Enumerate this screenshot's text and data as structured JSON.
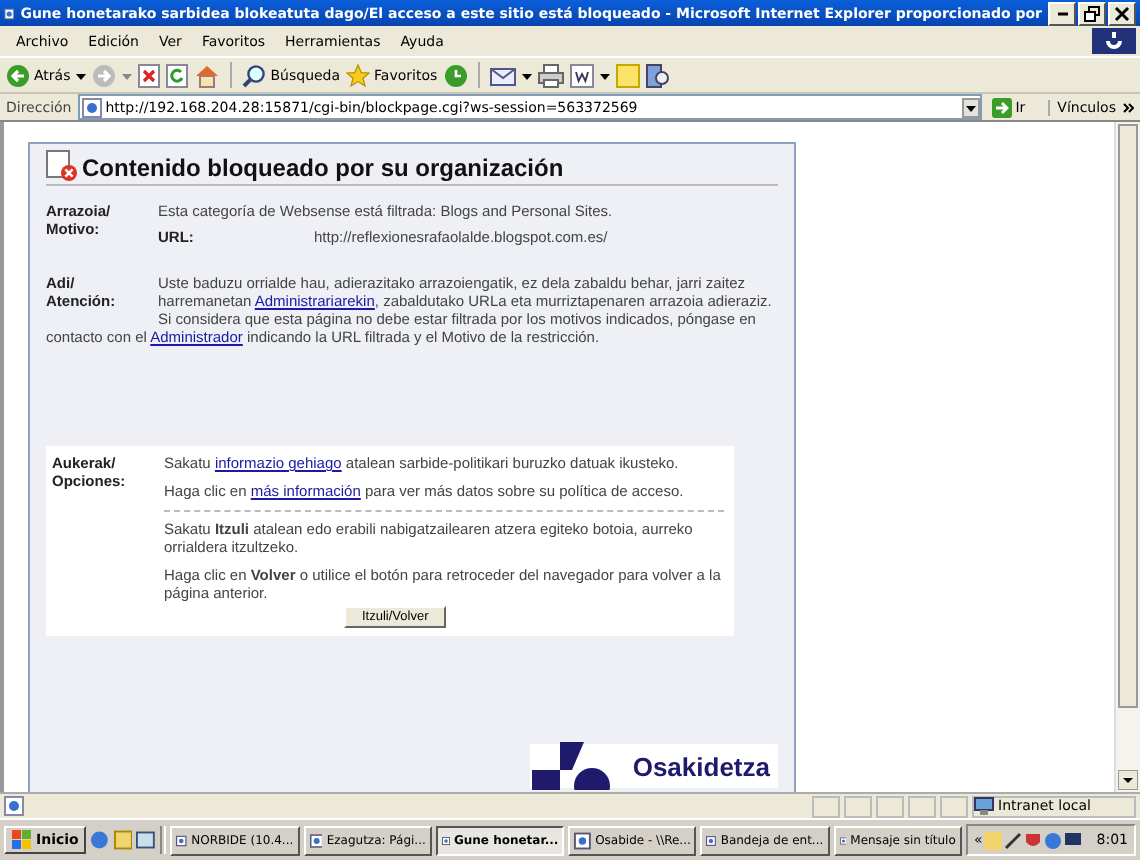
{
  "window": {
    "title": "Gune honetarako sarbidea blokeatuta dago/El acceso a este sitio está bloqueado - Microsoft Internet Explorer proporcionado por"
  },
  "menu_bar": [
    "Archivo",
    "Edición",
    "Ver",
    "Favoritos",
    "Herramientas",
    "Ayuda"
  ],
  "toolbar": {
    "back": "Atrás",
    "search": "Búsqueda",
    "favorites": "Favoritos"
  },
  "address_bar": {
    "label": "Dirección",
    "value": "http://192.168.204.28:15871/cgi-bin/blockpage.cgi?ws-session=563372569",
    "go": "Ir",
    "links": "Vínculos"
  },
  "page": {
    "heading": "Contenido bloqueado por su organización",
    "reason": {
      "label": "Arrazoia/ Motivo:",
      "text": "Esta categoría de Websense está filtrada: Blogs and Personal Sites.",
      "url_label": "URL:",
      "url": "http://reflexionesrafaolalde.blogspot.com.es/"
    },
    "attention": {
      "label": "Adi/ Atención:",
      "paragraphs": [
        {
          "before": "Uste baduzu orrialde hau, adierazitako arrazoiengatik, ez dela zabaldu behar, jarri zaitez harremanetan",
          "link": "Administrariarekin",
          "after": ", zabaldutako URLa eta murriztapenaren arrazoia adieraziz."
        },
        {
          "before": "Si considera que esta página no debe estar filtrada por los motivos indicados, póngase en contacto con el",
          "link": "Administrador",
          "after": "indicando la URL filtrada y el Motivo de la restricción."
        }
      ]
    },
    "options": {
      "label": "Aukerak/ Opciones:",
      "links": [
        {
          "before": "Sakatu",
          "link": "informazio gehiago",
          "after": "atalean sarbide-politikari buruzko datuak ikusteko."
        },
        {
          "before": "Haga clic en",
          "link": "más información",
          "after": "para ver más datos sobre su política de acceso."
        }
      ],
      "back_texts": [
        "Sakatu **Itzuli** atalean edo erabili nabigatzailearen atzera egiteko botoia, aurreko orrialdera itzultzeko.",
        "Haga clic en **Volver** o utilice el botón para retroceder del navegador para volver a la página anterior."
      ],
      "button": "Itzuli/Volver"
    },
    "logo": "Osakidetza"
  },
  "status_bar": {
    "zone": "Intranet local"
  },
  "taskbar": {
    "start": "Inicio",
    "tasks": [
      {
        "label": "NORBIDE (10.4...",
        "selected": false
      },
      {
        "label": "Ezagutza: Pági...",
        "selected": false
      },
      {
        "label": "Gune honetar...",
        "selected": true
      },
      {
        "label": "Osabide - \\\\Re...",
        "selected": false
      },
      {
        "label": "Bandeja de ent...",
        "selected": false
      },
      {
        "label": "Mensaje sin título",
        "selected": false
      }
    ],
    "tray_toggle": "«",
    "clock": "8:01"
  }
}
